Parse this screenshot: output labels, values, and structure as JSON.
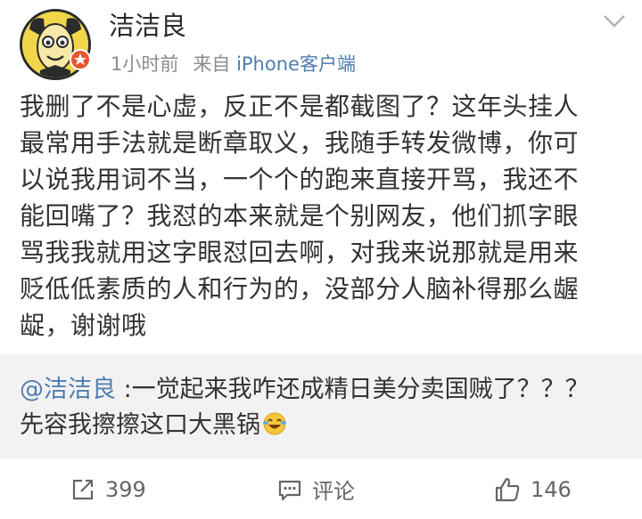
{
  "user": {
    "name": "洁洁良",
    "time": "1小时前",
    "from_label": "来自",
    "source": "iPhone客户端",
    "avatar_icon": "cartoon-face-avatar",
    "badge_color": "#e8542f"
  },
  "post": {
    "lines": [
      "我删了不是心虚，反正不是都截图了？这年头挂人",
      "最常用手法就是断章取义，我随手转发微博，你可",
      "以说我用词不当，一个个的跑来直接开骂，我还不",
      "能回嘴了？我怼的本来就是个别网友，他们抓字眼",
      "骂我我就用这字眼怼回去啊，对我来说那就是用来",
      "贬低低素质的人和行为的，没部分人脑补得那么龌",
      "龊，谢谢哦"
    ]
  },
  "repost": {
    "mention": "@洁洁良",
    "line1_rest": " :一觉起来我咋还成精日美分卖国贼了？？？",
    "line2": "先容我擦擦这口大黑锅",
    "emoji": "laugh-cry-emoji"
  },
  "actions": {
    "repost_count": "399",
    "comment_label": "评论",
    "like_count": "146"
  },
  "colors": {
    "link": "#507daf",
    "meta": "#8c8c8c",
    "repost_bg": "#f2f2f2"
  }
}
